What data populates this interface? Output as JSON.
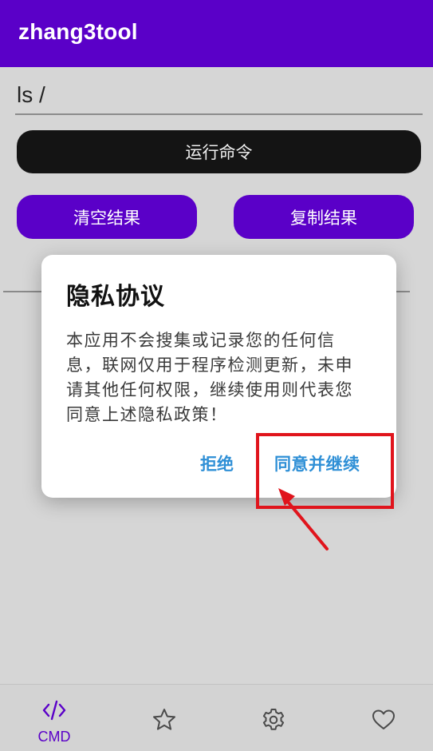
{
  "app": {
    "title": "zhang3tool"
  },
  "command": {
    "value": "ls /"
  },
  "buttons": {
    "run": "运行命令",
    "clear": "清空结果",
    "copy": "复制结果"
  },
  "dialog": {
    "title": "隐私协议",
    "body": "本应用不会搜集或记录您的任何信息，联网仅用于程序检测更新，未申请其他任何权限，继续使用则代表您同意上述隐私政策！",
    "reject": "拒绝",
    "agree": "同意并继续"
  },
  "bottom_nav": {
    "items": [
      {
        "label": "CMD",
        "icon": "code-icon",
        "active": true
      },
      {
        "icon": "star-icon"
      },
      {
        "icon": "gear-icon"
      },
      {
        "icon": "heart-icon"
      }
    ]
  },
  "colors": {
    "primary": "#5a00c8",
    "run_button": "#141414",
    "dialog_action": "#2e8fd6",
    "highlight": "#e0141c"
  }
}
